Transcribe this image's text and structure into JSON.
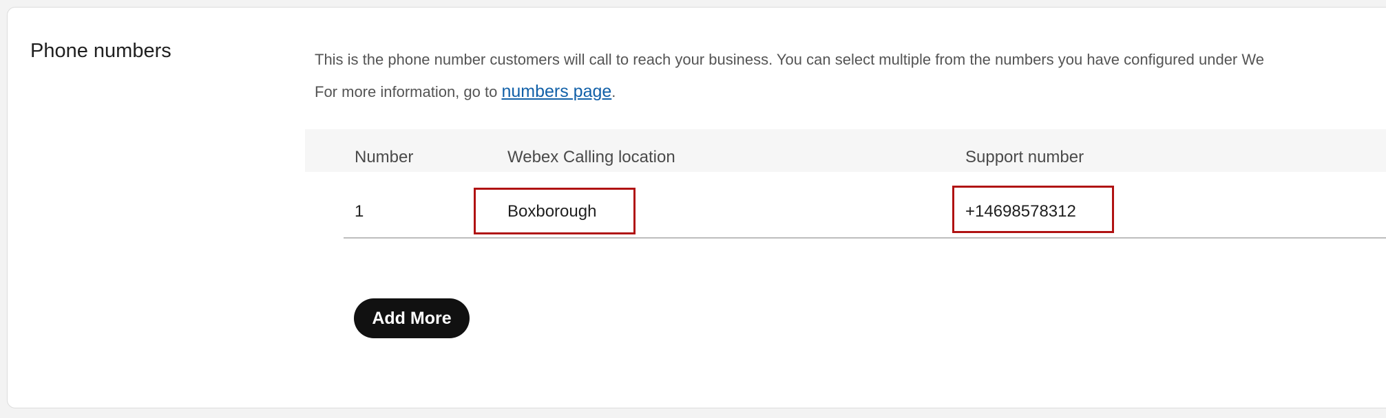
{
  "section": {
    "title": "Phone numbers",
    "description_line1": "This is the phone number customers will call to reach your business. You can select multiple from the numbers you have configured under We",
    "description_line2_prefix": "For more information, go to ",
    "description_link": "numbers page",
    "description_line2_suffix": "."
  },
  "table": {
    "headers": [
      "Number",
      "Webex Calling location",
      "Support number"
    ],
    "rows": [
      {
        "number": "1",
        "location": "Boxborough",
        "support_number": "+14698578312"
      }
    ]
  },
  "actions": {
    "add_more_label": "Add More"
  },
  "colors": {
    "highlight": "#b01212",
    "link": "#1160a8",
    "button_bg": "#111111"
  }
}
